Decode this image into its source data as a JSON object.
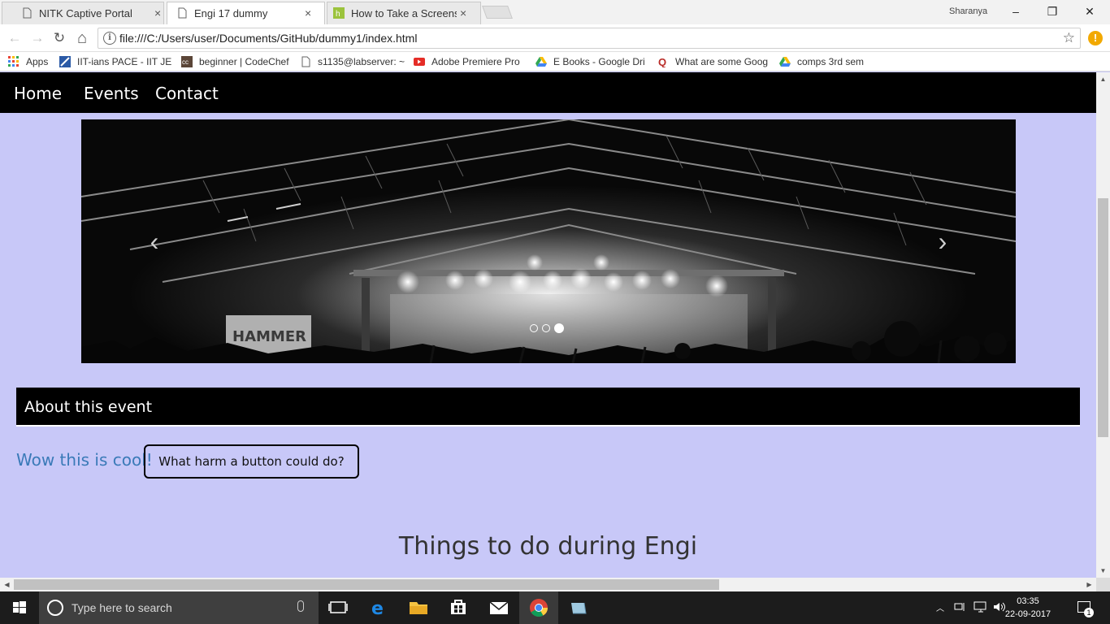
{
  "browser": {
    "tabs": [
      {
        "label": "NITK Captive Portal",
        "close": "×",
        "active": false
      },
      {
        "label": "Engi 17 dummy",
        "close": "×",
        "active": true
      },
      {
        "label": "How to Take a Screensho",
        "close": "×",
        "active": false
      }
    ],
    "profile": "Sharanya",
    "window_controls": {
      "minimize": "–",
      "restore": "❐",
      "close": "✕"
    },
    "nav": {
      "back": "←",
      "forward": "→",
      "reload": "↻",
      "home": "⌂"
    },
    "address": "file:///C:/Users/user/Documents/GitHub/dummy1/index.html",
    "alert_glyph": "!",
    "bookmarks": [
      {
        "label": "Apps",
        "icon": "apps-grid-icon"
      },
      {
        "label": "IIT-ians PACE - IIT JEE",
        "icon": "site-icon"
      },
      {
        "label": "beginner | CodeChef",
        "icon": "codechef-icon"
      },
      {
        "label": "s1135@labserver: ~",
        "icon": "page-icon"
      },
      {
        "label": "Adobe Premiere Pro",
        "icon": "youtube-icon"
      },
      {
        "label": "E Books - Google Dri",
        "icon": "google-drive-icon"
      },
      {
        "label": "What are some Goog",
        "icon": "quora-icon"
      },
      {
        "label": "comps 3rd sem",
        "icon": "google-drive-icon"
      }
    ]
  },
  "site": {
    "nav": {
      "home": "Home",
      "events": "Events",
      "contact": "Contact"
    },
    "carousel": {
      "prev": "‹",
      "next": "›",
      "slide_count": 3,
      "active_slide": 3,
      "banner_text": "HAMMER"
    },
    "about_heading": "About this event",
    "cool_text": "Wow this is cool!",
    "button_label": "What harm a button could do?",
    "section_heading": "Things to do during Engi"
  },
  "taskbar": {
    "search_placeholder": "Type here to search",
    "time": "03:35",
    "date": "22-09-2017",
    "notification_count": "1",
    "pinned": [
      "task-view-icon",
      "edge-icon",
      "file-explorer-icon",
      "store-icon",
      "mail-icon",
      "chrome-icon",
      "app-icon"
    ]
  },
  "colors": {
    "page_bg": "#c8c8f8",
    "nav_bg": "#000000",
    "link_blue": "#3a7ab8"
  }
}
